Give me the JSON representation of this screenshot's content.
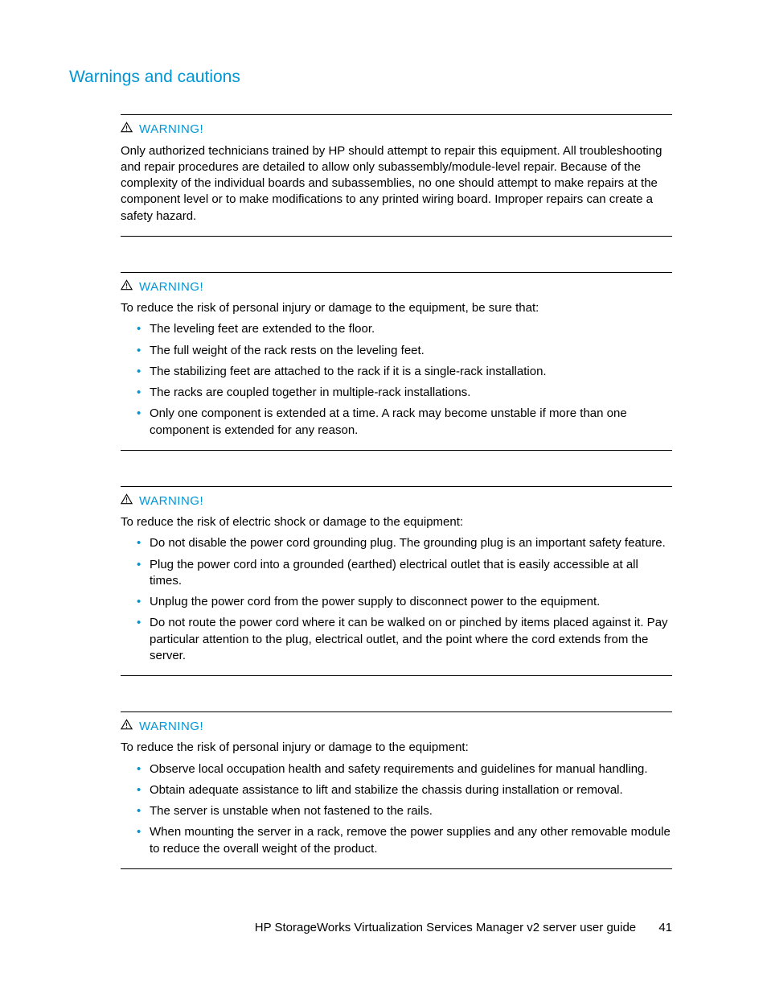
{
  "section_title": "Warnings and cautions",
  "warning_label": "WARNING!",
  "warnings": [
    {
      "intro": "",
      "para": "Only authorized technicians trained by HP should attempt to repair this equipment. All troubleshooting and repair procedures are detailed to allow only subassembly/module-level repair. Because of the complexity of the individual boards and subassemblies, no one should attempt to make repairs at the component level or to make modifications to any printed wiring board. Improper repairs can create a safety hazard.",
      "items": []
    },
    {
      "intro": "To reduce the risk of personal injury or damage to the equipment, be sure that:",
      "para": "",
      "items": [
        "The leveling feet are extended to the floor.",
        "The full weight of the rack rests on the leveling feet.",
        "The stabilizing feet are attached to the rack if it is a single-rack installation.",
        "The racks are coupled together in multiple-rack installations.",
        "Only one component is extended at a time. A rack may become unstable if more than one component is extended for any reason."
      ]
    },
    {
      "intro": "To reduce the risk of electric shock or damage to the equipment:",
      "para": "",
      "items": [
        "Do not disable the power cord grounding plug. The grounding plug is an important safety feature.",
        "Plug the power cord into a grounded (earthed) electrical outlet that is easily accessible at all times.",
        "Unplug the power cord from the power supply to disconnect power to the equipment.",
        "Do not route the power cord where it can be walked on or pinched by items placed against it. Pay particular attention to the plug, electrical outlet, and the point where the cord extends from the server."
      ]
    },
    {
      "intro": "To reduce the risk of personal injury or damage to the equipment:",
      "para": "",
      "items": [
        "Observe local occupation health and safety requirements and guidelines for manual handling.",
        "Obtain adequate assistance to lift and stabilize the chassis during installation or removal.",
        "The server is unstable when not fastened to the rails.",
        "When mounting the server in a rack, remove the power supplies and any other removable module to reduce the overall weight of the product."
      ]
    }
  ],
  "footer": {
    "title": "HP StorageWorks Virtualization Services Manager v2 server user guide",
    "page": "41"
  }
}
